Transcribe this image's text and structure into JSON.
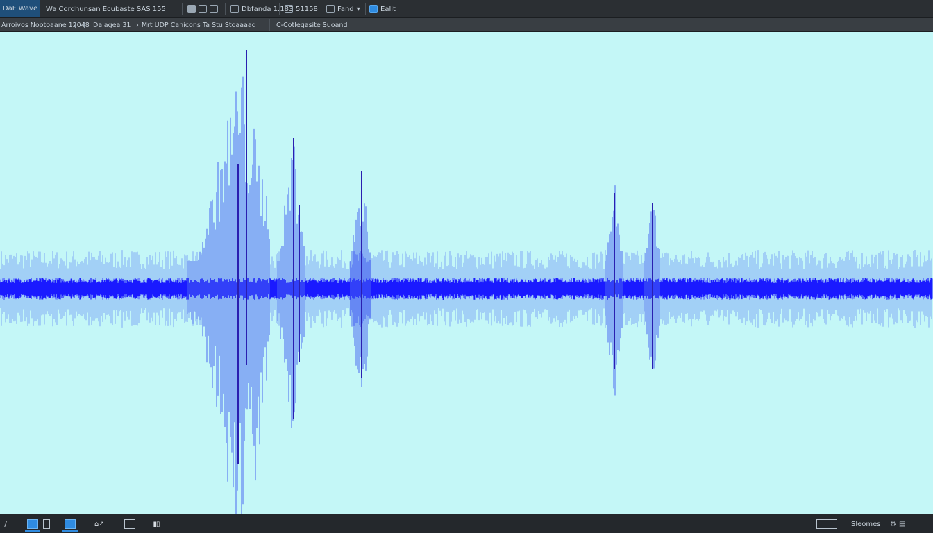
{
  "toolbar": {
    "app_button": "DaF Wave",
    "group1": "Wa Cordhunsan Ecubaste SAS 155",
    "group3": "Dbfanda 1.183",
    "group4": "51158",
    "group5": "Fand",
    "group6": "Ealit"
  },
  "secondary_bar": {
    "item1": "Arroivos Nootoaane 12048",
    "item2": "Daiagea 31",
    "item3": "Mrt UDP Canicons",
    "item4": "Ta Stu Stoaaaad",
    "item5": "C-Cotlegasite Suoand"
  },
  "taskbar": {
    "tray_label_1": "Sleomes"
  },
  "colors": {
    "canvas_bg": "#c4f7f7",
    "waveform_core": "#1a1aff",
    "waveform_light": "#4a67f2",
    "chrome_bg": "#2b2f33"
  },
  "icons": [
    "file-icon",
    "monitor-icon",
    "window-icon",
    "grid-icon",
    "document-icon",
    "chart-icon",
    "settings-icon"
  ]
}
